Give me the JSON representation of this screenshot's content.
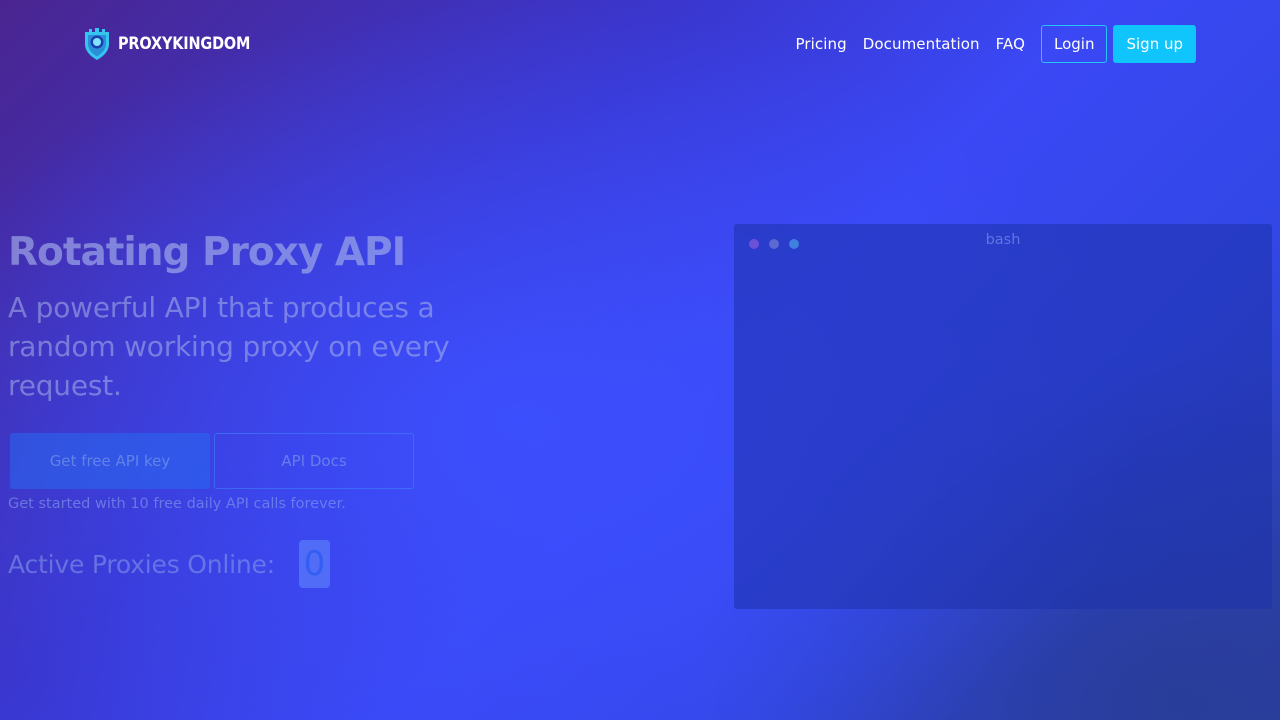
{
  "brand": {
    "name": "PROXYKINGDOM",
    "logo_icon": "shield-castle-icon"
  },
  "nav": {
    "links": [
      "Pricing",
      "Documentation",
      "FAQ"
    ],
    "login_label": "Login",
    "signup_label": "Sign up"
  },
  "hero": {
    "title": "Rotating Proxy API",
    "subtitle": "A powerful API that produces a random working proxy on every request.",
    "primary_button": "Get free API key",
    "secondary_button": "API Docs",
    "note": "Get started with 10 free daily API calls forever.",
    "proxies_label": "Active Proxies Online:",
    "proxies_count": "0"
  },
  "terminal": {
    "title": "bash",
    "dot_colors": [
      "#6a52d8",
      "#5a6ad0",
      "#3f7fe0"
    ]
  },
  "colors": {
    "accent": "#0fc5fb",
    "login_border": "#22c7f5"
  }
}
